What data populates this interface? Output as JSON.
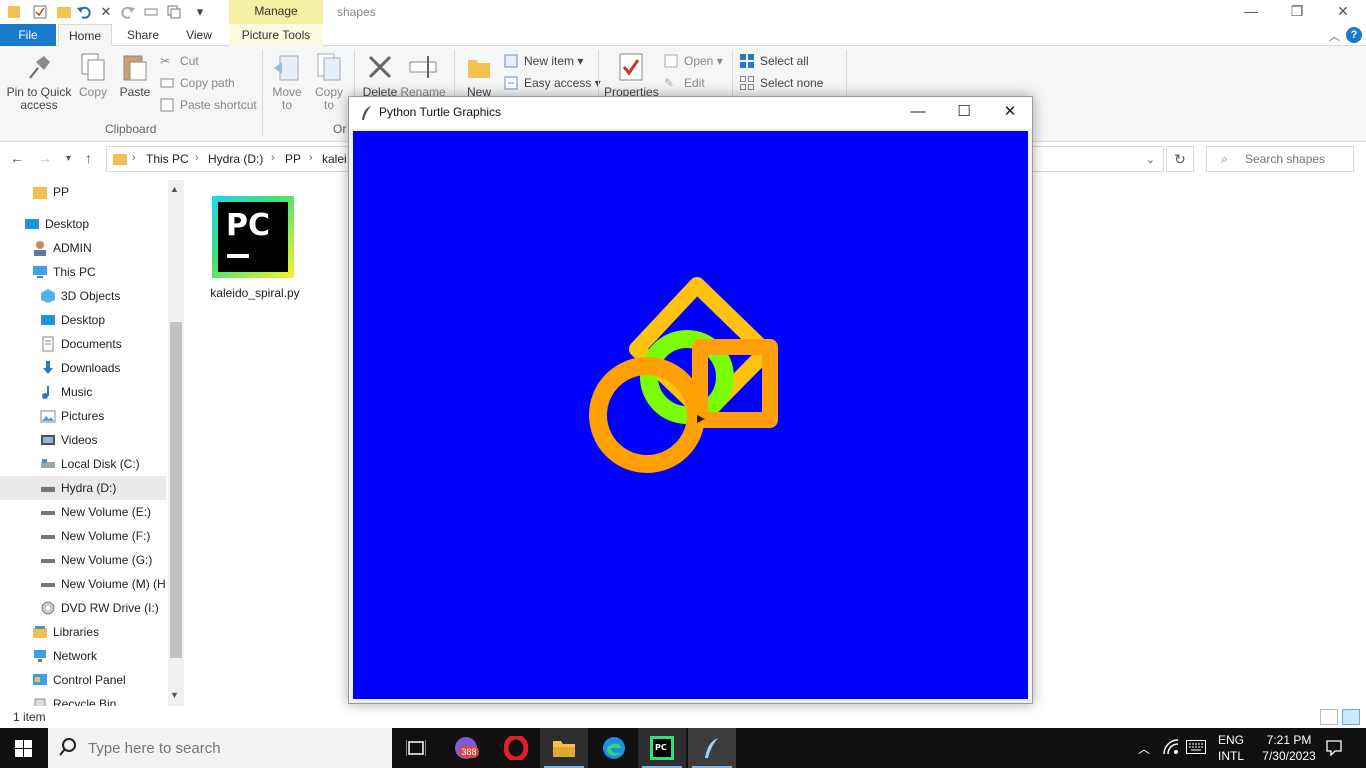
{
  "window": {
    "title": "shapes",
    "manage_tab": "Manage"
  },
  "ribbon_tabs": {
    "file": "File",
    "home": "Home",
    "share": "Share",
    "view": "View",
    "picture_tools": "Picture Tools"
  },
  "ribbon": {
    "pin_to_quick_access": "Pin to Quick access",
    "copy": "Copy",
    "paste": "Paste",
    "cut": "Cut",
    "copy_path": "Copy path",
    "paste_shortcut": "Paste shortcut",
    "clipboard_group": "Clipboard",
    "move_to": "Move to",
    "copy_to": "Copy to",
    "organize_group": "Or",
    "delete": "Delete",
    "rename": "Rename",
    "new_folder": "New",
    "new_item": "New item",
    "easy_access": "Easy access",
    "properties": "Properties",
    "open": "Open",
    "edit": "Edit",
    "select_all": "Select all",
    "select_none": "Select none"
  },
  "address": {
    "crumbs": [
      "This PC",
      "Hydra (D:)",
      "PP",
      "kalei"
    ],
    "search_placeholder": "Search shapes"
  },
  "nav_pane": {
    "items": [
      {
        "label": "PP",
        "icon": "folder-icon"
      },
      {
        "label": "Desktop",
        "icon": "desktop-icon"
      },
      {
        "label": "ADMIN",
        "icon": "user-icon"
      },
      {
        "label": "This PC",
        "icon": "pc-icon"
      },
      {
        "label": "3D Objects",
        "icon": "cube-icon"
      },
      {
        "label": "Desktop",
        "icon": "desktop-icon"
      },
      {
        "label": "Documents",
        "icon": "document-icon"
      },
      {
        "label": "Downloads",
        "icon": "download-icon"
      },
      {
        "label": "Music",
        "icon": "music-icon"
      },
      {
        "label": "Pictures",
        "icon": "pictures-icon"
      },
      {
        "label": "Videos",
        "icon": "video-icon"
      },
      {
        "label": "Local Disk (C:)",
        "icon": "disk-icon"
      },
      {
        "label": "Hydra (D:)",
        "icon": "drive-icon"
      },
      {
        "label": "New Volume (E:)",
        "icon": "drive-icon"
      },
      {
        "label": "New Volume (F:)",
        "icon": "drive-icon"
      },
      {
        "label": "New Volume (G:)",
        "icon": "drive-icon"
      },
      {
        "label": "New Voiume (M) (H",
        "icon": "drive-icon"
      },
      {
        "label": "DVD RW Drive (I:)",
        "icon": "dvd-icon"
      },
      {
        "label": "Libraries",
        "icon": "library-icon"
      },
      {
        "label": "Network",
        "icon": "network-icon"
      },
      {
        "label": "Control Panel",
        "icon": "control-panel-icon"
      },
      {
        "label": "Recycle Bin",
        "icon": "recycle-bin-icon"
      }
    ]
  },
  "files": [
    {
      "name": "kaleido_spiral.py",
      "icon": "pycharm-icon"
    }
  ],
  "status": {
    "item_count": "1 item"
  },
  "turtle_window": {
    "title": "Python Turtle Graphics",
    "canvas_color": "#0000ff",
    "shapes": [
      {
        "type": "diamond",
        "color": "#ffc20e"
      },
      {
        "type": "circle",
        "color": "#7cfc00"
      },
      {
        "type": "square",
        "color": "#ff9f0a"
      },
      {
        "type": "circle",
        "color": "#ffa000"
      }
    ]
  },
  "taskbar": {
    "search_placeholder": "Type here to search",
    "badge_count": "388",
    "language": "ENG",
    "layout": "INTL",
    "time": "7:21 PM",
    "date": "7/30/2023"
  }
}
